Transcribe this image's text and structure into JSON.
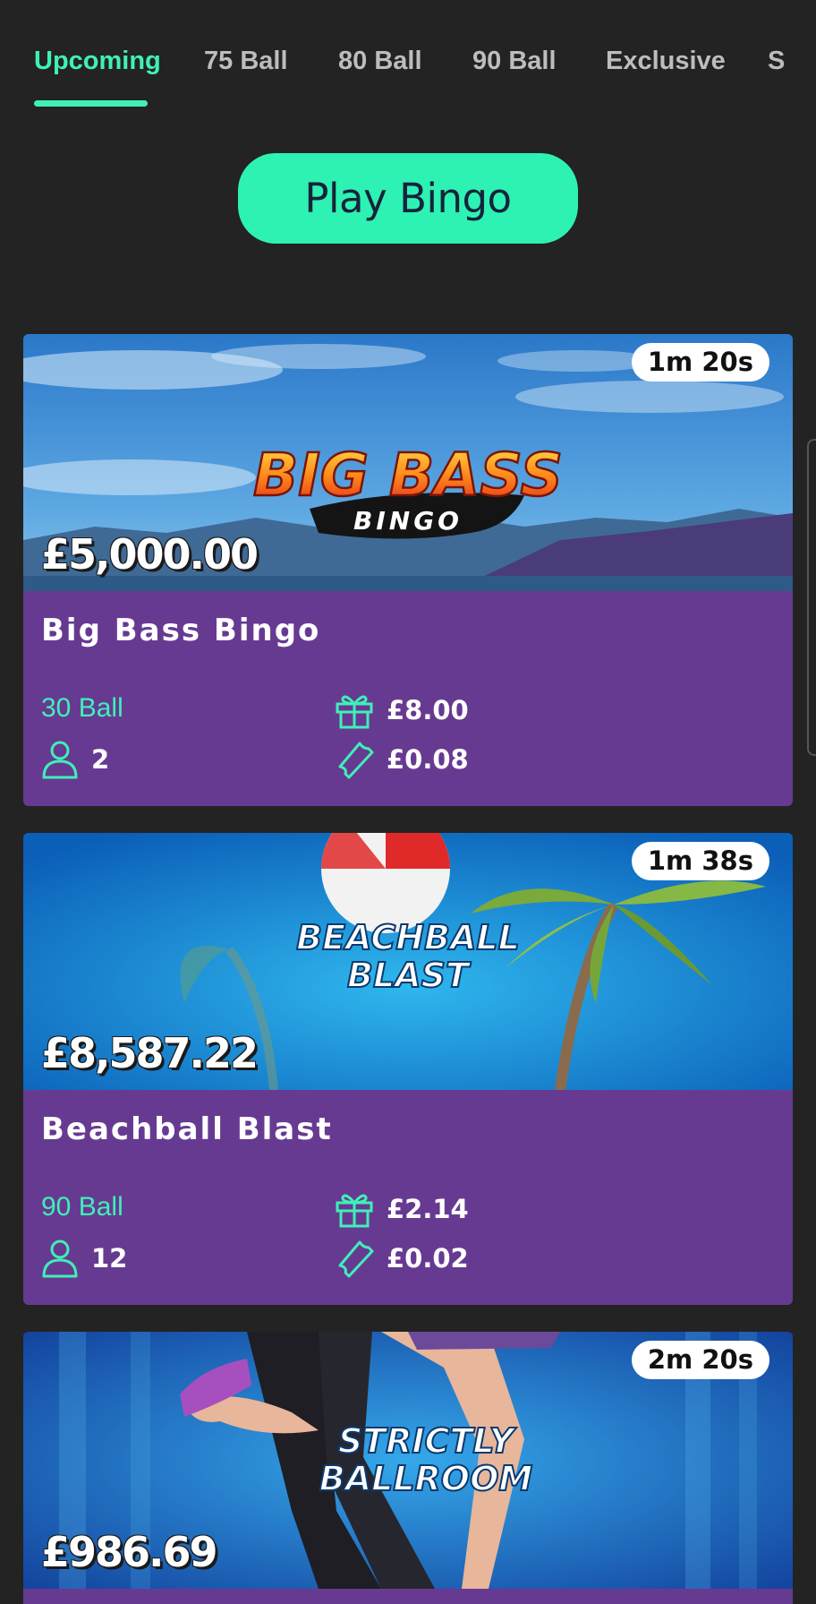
{
  "tabs": [
    {
      "label": "Upcoming",
      "active": true
    },
    {
      "label": "75 Ball",
      "active": false
    },
    {
      "label": "80 Ball",
      "active": false
    },
    {
      "label": "90 Ball",
      "active": false
    },
    {
      "label": "Exclusive",
      "active": false
    },
    {
      "label": "S",
      "active": false
    }
  ],
  "play_button": {
    "label": "Play Bingo"
  },
  "games": [
    {
      "name": "Big Bass Bingo",
      "timer": "1m 20s",
      "jackpot": "£5,000.00",
      "ball_type": "30 Ball",
      "players": "2",
      "prize": "£8.00",
      "ticket_price": "£0.08",
      "logo_line1": "BIG BASS",
      "logo_line2": "BINGO"
    },
    {
      "name": "Beachball Blast",
      "timer": "1m 38s",
      "jackpot": "£8,587.22",
      "ball_type": "90 Ball",
      "players": "12",
      "prize": "£2.14",
      "ticket_price": "£0.02",
      "logo_line1": "BEACHBALL",
      "logo_line2": "BLAST"
    },
    {
      "timer": "2m 20s",
      "jackpot": "£986.69",
      "logo_line1": "STRICTLY",
      "logo_line2": "BALLROOM"
    }
  ],
  "colors": {
    "accent": "#3ff0b7",
    "card_body": "#673a92",
    "background": "#232323"
  },
  "icons": [
    "user-icon",
    "gift-icon",
    "ticket-icon"
  ]
}
